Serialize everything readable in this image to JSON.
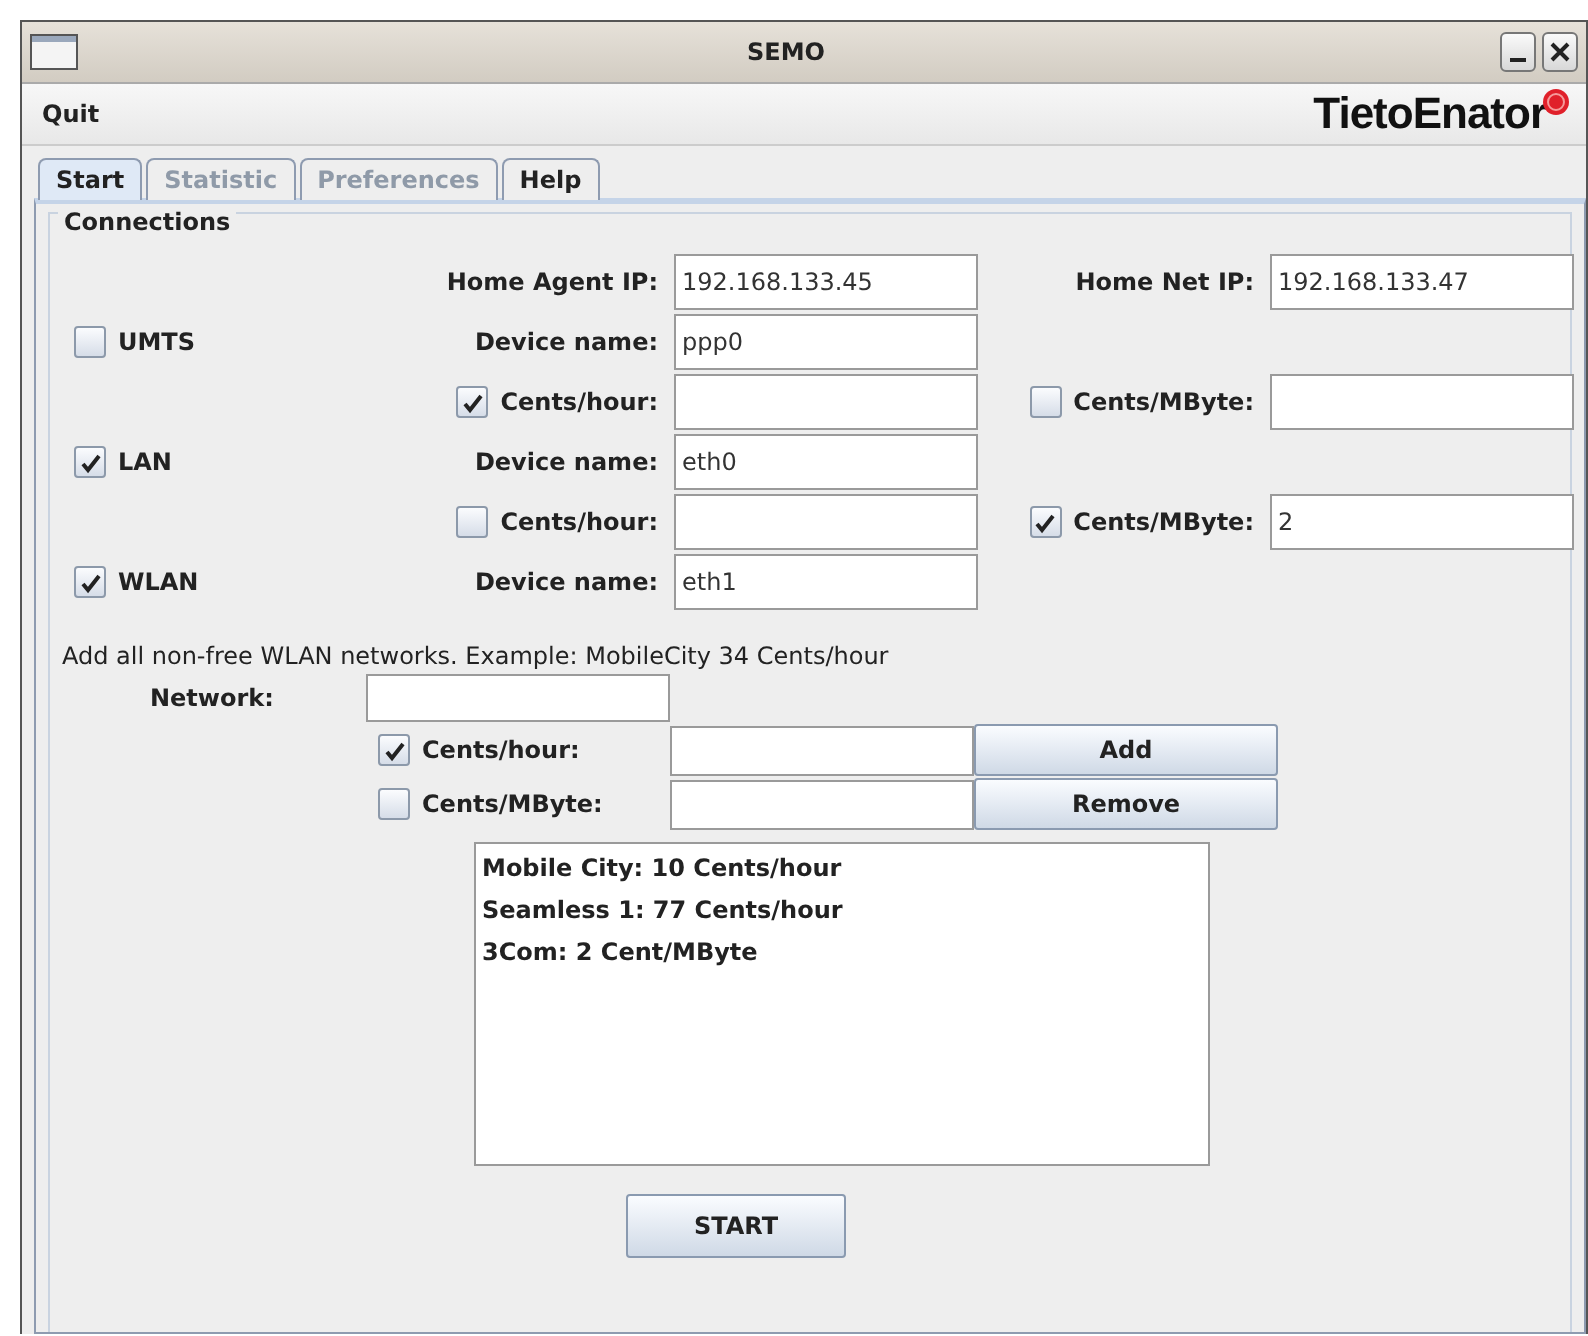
{
  "window": {
    "title": "SEMO"
  },
  "menu": {
    "items": [
      "Quit"
    ],
    "logo": "TietoEnator"
  },
  "tabs": [
    {
      "label": "Start",
      "selected": true,
      "disabled": false
    },
    {
      "label": "Statistic",
      "selected": false,
      "disabled": true
    },
    {
      "label": "Preferences",
      "selected": false,
      "disabled": true
    },
    {
      "label": "Help",
      "selected": false,
      "disabled": false
    }
  ],
  "connections": {
    "title": "Connections",
    "home_agent": {
      "label": "Home Agent IP:",
      "value": "192.168.133.45"
    },
    "home_net": {
      "label": "Home Net IP:",
      "value": "192.168.133.47"
    },
    "interfaces": [
      {
        "name": "UMTS",
        "checked": false,
        "device_label": "Device name:",
        "device": "ppp0",
        "costs": [
          {
            "label": "Cents/hour:",
            "checked": true
          },
          {
            "label": "Cents/MByte:",
            "checked": false
          }
        ]
      },
      {
        "name": "LAN",
        "checked": true,
        "device_label": "Device name:",
        "device": "eth0",
        "costs": [
          {
            "label": "Cents/hour:",
            "checked": false
          },
          {
            "label": "Cents/MByte:",
            "checked": true,
            "value": "2"
          }
        ]
      },
      {
        "name": "WLAN",
        "checked": true,
        "device_label": "Device name:",
        "device": "eth1"
      }
    ]
  },
  "networks": {
    "hint": "Add all non-free WLAN networks. Example: MobileCity 34 Cents/hour",
    "network_label": "Network:",
    "rates": [
      {
        "label": "Cents/hour:",
        "checked": true,
        "button": "Add"
      },
      {
        "label": "Cents/MByte:",
        "checked": false,
        "button": "Remove"
      }
    ],
    "list": [
      "Mobile City: 10 Cents/hour",
      "Seamless 1: 77 Cents/hour",
      "3Com: 2 Cent/MByte"
    ]
  },
  "start_button": "START"
}
